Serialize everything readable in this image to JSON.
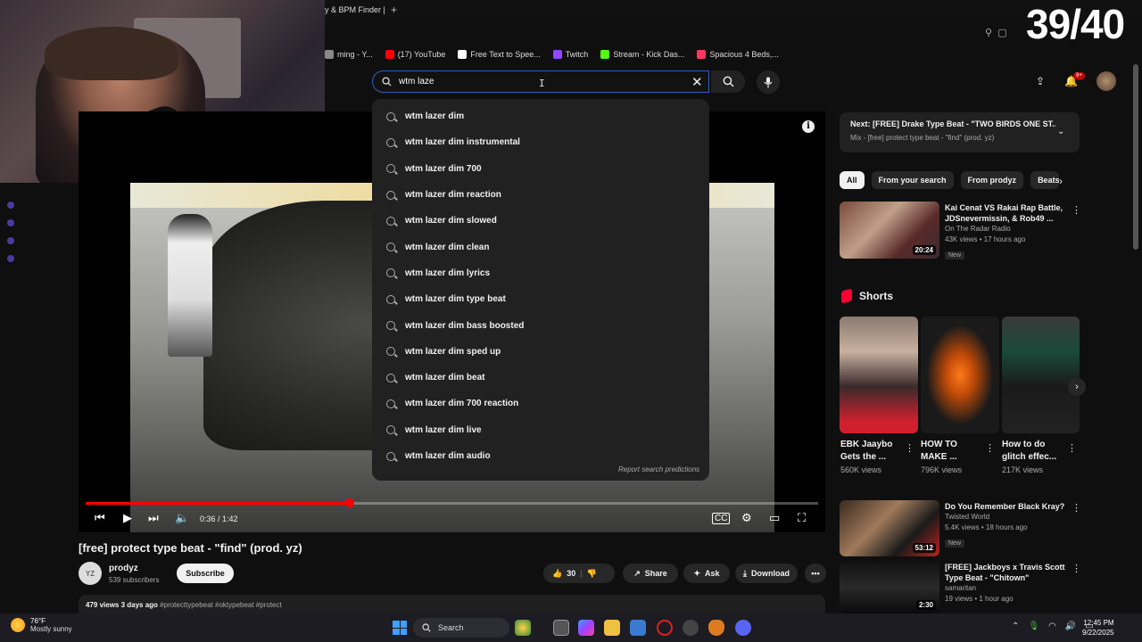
{
  "overlay": {
    "counter": "39/40"
  },
  "browser": {
    "tab_title": "y & BPM Finder |",
    "tab_plus": "+",
    "bookmarks": [
      {
        "label": "ming - Y...",
        "color": "#888888"
      },
      {
        "label": "(17) YouTube",
        "color": "#ff0000"
      },
      {
        "label": "Free Text to Spee...",
        "color": "#ffffff"
      },
      {
        "label": "Twitch",
        "color": "#9146ff"
      },
      {
        "label": "Stream - Kick Das...",
        "color": "#53fc18"
      },
      {
        "label": "Spacious 4 Beds,...",
        "color": "#ff385c"
      }
    ]
  },
  "search": {
    "value": "wtm laze",
    "suggestions": [
      "wtm lazer dim",
      "wtm lazer dim instrumental",
      "wtm lazer dim 700",
      "wtm lazer dim reaction",
      "wtm lazer dim slowed",
      "wtm lazer dim clean",
      "wtm lazer dim lyrics",
      "wtm lazer dim type beat",
      "wtm lazer dim bass boosted",
      "wtm lazer dim sped up",
      "wtm lazer dim beat",
      "wtm lazer dim 700 reaction",
      "wtm lazer dim live",
      "wtm lazer dim audio"
    ],
    "report": "Report search predictions"
  },
  "header": {
    "notif_count": "9+"
  },
  "player": {
    "time": "0:36 / 1:42",
    "progress": 0.36
  },
  "video": {
    "title": "[free] protect type beat - \"find\" (prod. yz)",
    "channel": "prodyz",
    "channel_initials": "YZ",
    "subscribers": "539 subscribers",
    "subscribe": "Subscribe",
    "likes": "30",
    "share": "Share",
    "ask": "Ask",
    "download": "Download",
    "desc_meta": "479 views  3 days ago",
    "desc_tags": "#protecttypebeat #oktypebeat #protect"
  },
  "next": {
    "title": "Next: [FREE] Drake Type Beat - \"TWO BIRDS ONE ST...",
    "subtitle": "Mix - [free] protect type beat - \"find\" (prod. yz)"
  },
  "chips": [
    "All",
    "From your search",
    "From prodyz",
    "Beats"
  ],
  "recommended": [
    {
      "title": "Kai Cenat VS Rakai Rap Battle, JDSnevermissin, & Rob49 ...",
      "channel": "On The Radar Radio",
      "meta": "43K views • 17 hours ago",
      "badge": "New",
      "duration": "20:24"
    },
    {
      "title": "Do You Remember Black Kray?",
      "channel": "Twisted World",
      "meta": "5.4K views • 18 hours ago",
      "badge": "New",
      "duration": "53:12"
    },
    {
      "title": "[FREE] Jackboys x Travis Scott Type Beat - \"Chitown\"",
      "channel": "samaritan",
      "meta": "19 views • 1 hour ago",
      "badge": "",
      "duration": "2:30"
    }
  ],
  "shorts": {
    "heading": "Shorts",
    "items": [
      {
        "title": "EBK Jaaybo Gets the ...",
        "views": "560K views"
      },
      {
        "title": "HOW TO MAKE ...",
        "views": "796K views"
      },
      {
        "title": "How to do glitch effec...",
        "views": "217K views"
      }
    ]
  },
  "taskbar": {
    "temp": "76°F",
    "weather": "Mostly sunny",
    "search": "Search",
    "time": "12:45 PM",
    "date": "9/22/2025"
  }
}
